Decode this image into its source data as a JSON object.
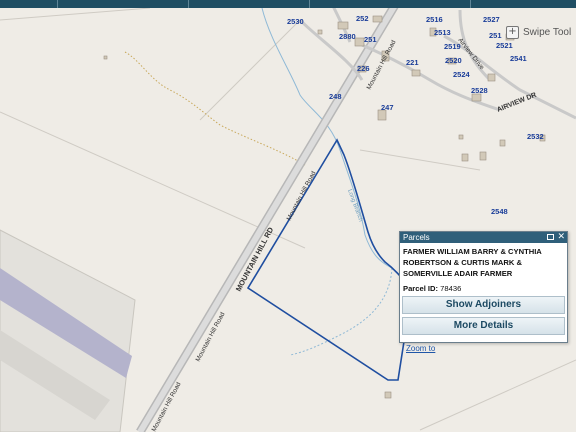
{
  "toolbar": {
    "swipe_tool_label": "Swipe Tool"
  },
  "map": {
    "road_labels": [
      {
        "text": "MOUNTAIN HILL RD",
        "weight": "bold"
      },
      {
        "text": "Mountain Hill Road",
        "weight": "normal"
      },
      {
        "text": "Mountain Hill Road",
        "weight": "normal"
      },
      {
        "text": "Mountain Hill Road",
        "weight": "normal"
      },
      {
        "text": "Mountain Hill Road",
        "weight": "normal"
      },
      {
        "text": "AIRVIEW DR",
        "weight": "bold"
      },
      {
        "text": "Airview Drive",
        "weight": "normal"
      }
    ],
    "stream_label": "Long Branch",
    "parcel_numbers": [
      "2530",
      "252",
      "2516",
      "2527",
      "2880",
      "251",
      "2513",
      "251",
      "2521",
      "2519",
      "2541",
      "221",
      "2520",
      "2524",
      "2528",
      "248",
      "247",
      "2532",
      "2548",
      "226"
    ],
    "colors": {
      "parcel_outline": "#1f4ea0",
      "parcel_number": "#1a3d99",
      "road": "#bdbdbd",
      "stream": "#8fb9d6",
      "runway": "#b4b3cc",
      "background": "#efece6"
    }
  },
  "popup": {
    "title": "Parcels",
    "owner": "FARMER WILLIAM BARRY & CYNTHIA ROBERTSON & CURTIS MARK & SOMERVILLE ADAIR FARMER",
    "parcel_id_label": "Parcel ID:",
    "parcel_id_value": "78436",
    "show_adjoiners_label": "Show Adjoiners",
    "more_details_label": "More Details",
    "zoom_link_label": "Zoom to",
    "icons": [
      "maximize-icon",
      "close-icon"
    ]
  }
}
